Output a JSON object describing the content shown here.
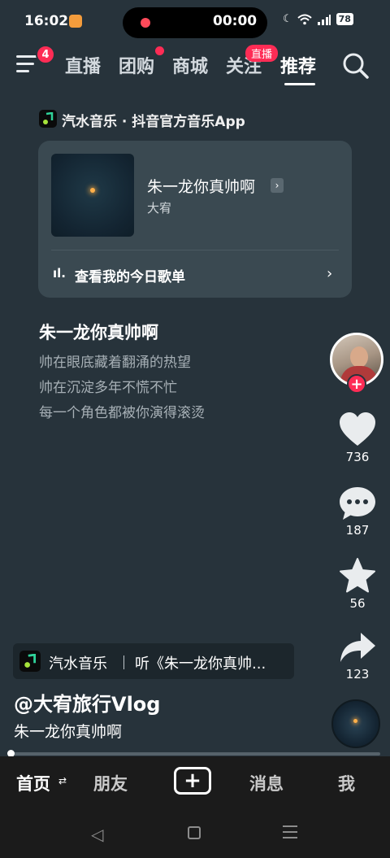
{
  "status_bar": {
    "time": "16:02",
    "timer": "00:00",
    "battery": "78"
  },
  "top_nav": {
    "menu_badge": "4",
    "tabs": [
      {
        "label": "直播"
      },
      {
        "label": "团购"
      },
      {
        "label": "商城"
      },
      {
        "label": "关注"
      },
      {
        "label": "推荐"
      }
    ],
    "live_badge": "直播",
    "active_tab": "推荐"
  },
  "music_header": {
    "title": "汽水音乐 · 抖音官方音乐App"
  },
  "song_card": {
    "title": "朱一龙你真帅啊",
    "artist": "大宥",
    "playlist_label": "查看我的今日歌单"
  },
  "lyrics": {
    "current": "朱一龙你真帅啊",
    "lines": [
      "帅在眼底藏着翻涌的热望",
      "帅在沉淀多年不慌不忙",
      "每一个角色都被你演得滚烫"
    ]
  },
  "rail": {
    "likes": "736",
    "comments": "187",
    "favorites": "56",
    "shares": "123"
  },
  "bottom_info": {
    "source_name": "汽水音乐",
    "source_song": "听《朱一龙你真帅...",
    "author": "@大宥旅行Vlog",
    "description": "朱一龙你真帅啊"
  },
  "progress": {
    "fraction": 0.01
  },
  "tabbar": {
    "home": "首页",
    "friends": "朋友",
    "create": "+",
    "messages": "消息",
    "me": "我"
  },
  "colors": {
    "accent": "#fe2c55",
    "background": "#27333b",
    "card": "#3a4951"
  }
}
